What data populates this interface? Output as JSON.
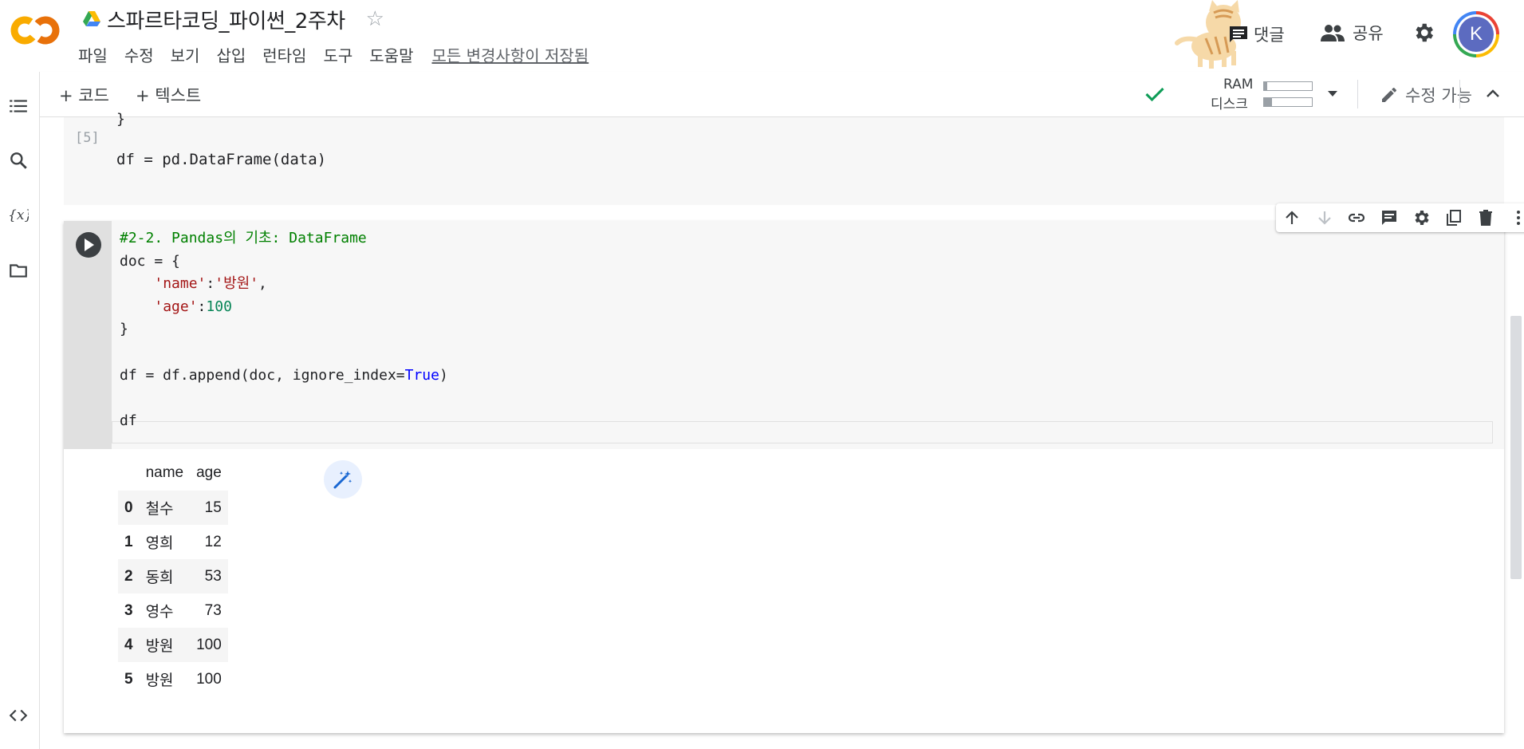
{
  "header": {
    "doc_title": "스파르타코딩_파이썬_2주차",
    "menu": [
      "파일",
      "수정",
      "보기",
      "삽입",
      "런타임",
      "도구",
      "도움말"
    ],
    "save_status": "모든 변경사항이 저장됨",
    "comment_label": "댓글",
    "share_label": "공유",
    "avatar_letter": "K",
    "icons": {
      "logo": "colab-logo",
      "drive": "drive-icon",
      "star": "star-icon",
      "comment": "comment-icon",
      "share": "people-icon",
      "settings": "gear-icon"
    }
  },
  "toolbar": {
    "add_code": "+ 코드",
    "add_text": "+ 텍스트",
    "ram_label": "RAM",
    "disk_label": "디스크",
    "ram_usage": 0.06,
    "disk_usage": 0.16,
    "edit_mode": "수정 가능"
  },
  "prev_cell": {
    "brace": "}",
    "exec_count": "[5]",
    "code": "df = pd.DataFrame(data)"
  },
  "cell": {
    "comment": "#2-2. Pandas의 기초: DataFrame",
    "line_doc_open": "doc = {",
    "indent": "    ",
    "key_name": "'name'",
    "val_name": "'방원'",
    "key_age": "'age'",
    "val_age": "100",
    "colon": ":",
    "comma": ",",
    "close_brace": "}",
    "append_prefix": "df = df.append(doc, ignore_index=",
    "true_kw": "True",
    "append_suffix": ")",
    "last_line": "df"
  },
  "output": {
    "columns": [
      "name",
      "age"
    ],
    "rows": [
      {
        "index": "0",
        "name": "철수",
        "age": "15"
      },
      {
        "index": "1",
        "name": "영희",
        "age": "12"
      },
      {
        "index": "2",
        "name": "동희",
        "age": "53"
      },
      {
        "index": "3",
        "name": "영수",
        "age": "73"
      },
      {
        "index": "4",
        "name": "방원",
        "age": "100"
      },
      {
        "index": "5",
        "name": "방원",
        "age": "100"
      }
    ]
  },
  "colors": {
    "accent": "#f9ab00",
    "brand_orange": "#e8710a",
    "check": "#0f9d58",
    "comment_code": "#008000",
    "string_code": "#a31515",
    "keyword_code": "#0000ff"
  }
}
